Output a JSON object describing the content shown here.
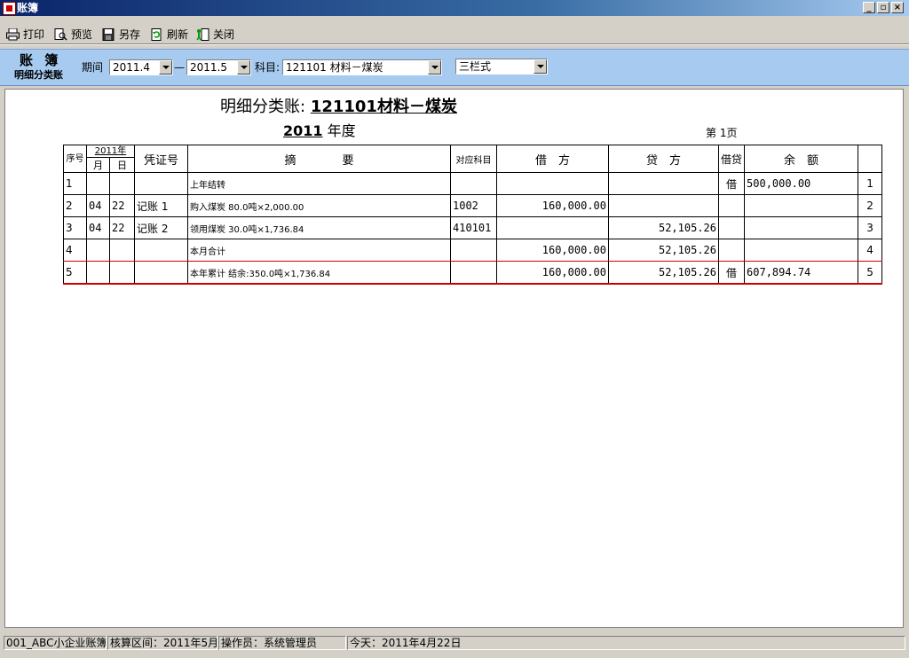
{
  "window": {
    "title": "账簿"
  },
  "toolbar": {
    "print": "打印",
    "preview": "预览",
    "save_as": "另存",
    "refresh": "刷新",
    "close": "关闭"
  },
  "filter": {
    "title": "账 簿",
    "subtitle": "明细分类账",
    "period_label": "期间",
    "period_from": "2011.4",
    "period_dash": "—",
    "period_to": "2011.5",
    "subject_label": "科目:",
    "subject_value": "121101 材料－煤炭",
    "format_value": "三栏式"
  },
  "report": {
    "title_prefix": "明细分类账:",
    "title_subject": "121101材料－煤炭",
    "year": "2011",
    "year_suffix": "年度",
    "page_label": "第 1页"
  },
  "ledger": {
    "headers": {
      "seq": "序号",
      "year": "2011年",
      "month": "月",
      "day": "日",
      "voucher": "凭证号",
      "summary": "摘　　　　要",
      "account": "对应科目",
      "debit": "借　方",
      "credit": "贷　方",
      "dc": "借贷",
      "balance": "余　额"
    },
    "rows": [
      {
        "seq": "1",
        "month": "",
        "day": "",
        "voucher": "",
        "summary": "上年结转",
        "account": "",
        "debit": "",
        "credit": "",
        "dc": "借",
        "balance": "500,000.00",
        "idx": "1"
      },
      {
        "seq": "2",
        "month": "04",
        "day": "22",
        "voucher": "记账 1",
        "summary": "购入煤炭 80.0吨×2,000.00",
        "account": "1002",
        "debit": "160,000.00",
        "credit": "",
        "dc": "",
        "balance": "",
        "idx": "2"
      },
      {
        "seq": "3",
        "month": "04",
        "day": "22",
        "voucher": "记账 2",
        "summary": "领用煤炭 30.0吨×1,736.84",
        "account": "410101",
        "debit": "",
        "credit": "52,105.26",
        "dc": "",
        "balance": "",
        "idx": "3"
      },
      {
        "seq": "4",
        "month": "",
        "day": "",
        "voucher": "",
        "summary": "本月合计",
        "account": "",
        "debit": "160,000.00",
        "credit": "52,105.26",
        "dc": "",
        "balance": "",
        "idx": "4"
      },
      {
        "seq": "5",
        "month": "",
        "day": "",
        "voucher": "",
        "summary": "本年累计 结余:350.0吨×1,736.84",
        "account": "",
        "debit": "160,000.00",
        "credit": "52,105.26",
        "dc": "借",
        "balance": "607,894.74",
        "idx": "5"
      }
    ]
  },
  "status": {
    "book": "001_ABC小企业账簿",
    "period": "核算区间：2011年5月",
    "operator": "操作员：系统管理员",
    "today": "今天：2011年4月22日"
  },
  "colors": {
    "title_bar": "#0a246a",
    "filter_bar": "#a6caf0",
    "summary_line": "#cc0000"
  }
}
